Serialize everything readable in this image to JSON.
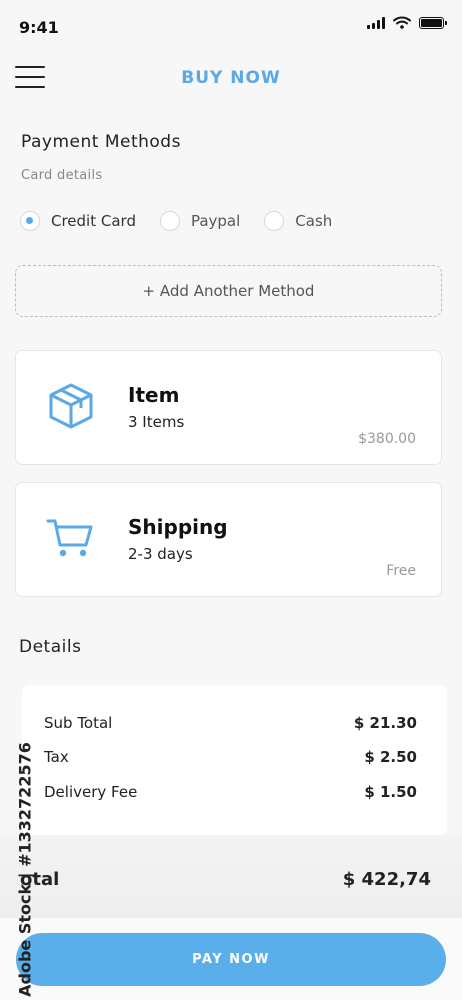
{
  "status": {
    "time": "9:41"
  },
  "header": {
    "title": "BUY NOW"
  },
  "payment": {
    "title": "Payment Methods",
    "subtitle": "Card details",
    "methods": [
      {
        "label": "Credit Card",
        "selected": true
      },
      {
        "label": "Paypal",
        "selected": false
      },
      {
        "label": "Cash",
        "selected": false
      }
    ],
    "add_method_label": "+ Add Another Method"
  },
  "item_card": {
    "title": "Item",
    "subtitle": "3 Items",
    "amount": "$380.00",
    "icon": "box-icon"
  },
  "shipping_card": {
    "title": "Shipping",
    "subtitle": "2-3 days",
    "amount": "Free",
    "icon": "cart-icon"
  },
  "details": {
    "title": "Details",
    "rows": [
      {
        "label": "Sub Total",
        "value": "$ 21.30"
      },
      {
        "label": "Tax",
        "value": "$ 2.50"
      },
      {
        "label": "Delivery Fee",
        "value": "$ 1.50"
      }
    ]
  },
  "total": {
    "label": "otal",
    "value": "$ 422,74"
  },
  "pay_button_label": "PAY NOW",
  "watermark": "Adobe Stock | #1332722576",
  "colors": {
    "accent": "#5aa9e6",
    "button": "#5aaeea"
  }
}
